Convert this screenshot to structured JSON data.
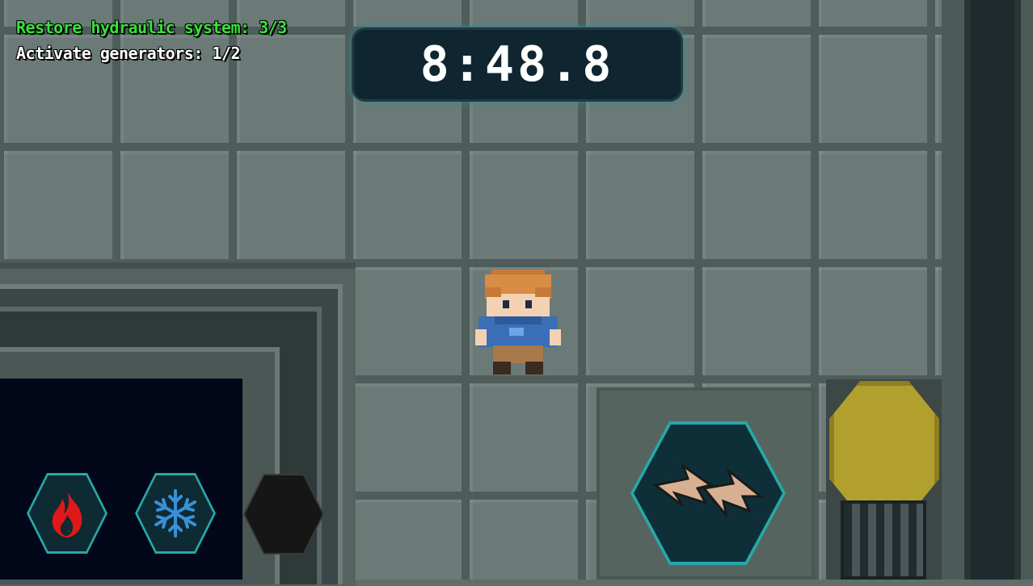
{
  "hud": {
    "objectives": [
      {
        "text": "Restore hydraulic system: 3/3",
        "status": "complete",
        "color": "#39e23a"
      },
      {
        "text": "Activate generators: 1/2",
        "status": "in-progress",
        "color": "#ffffff"
      }
    ],
    "timer": "8:48.8"
  },
  "abilities": [
    {
      "name": "fire-ability",
      "icon": "flame-icon",
      "color": "#e01818"
    },
    {
      "name": "ice-ability",
      "icon": "snowflake-icon",
      "color": "#3a8fd8"
    },
    {
      "name": "empty-ability-slot",
      "icon": "none",
      "color": "#161616"
    }
  ],
  "actions": {
    "interact": {
      "icon": "lightning-bolts-icon"
    }
  },
  "colors": {
    "accent": "#27a8a8",
    "panel": "#0f2630",
    "floor": "#6b7a77"
  }
}
